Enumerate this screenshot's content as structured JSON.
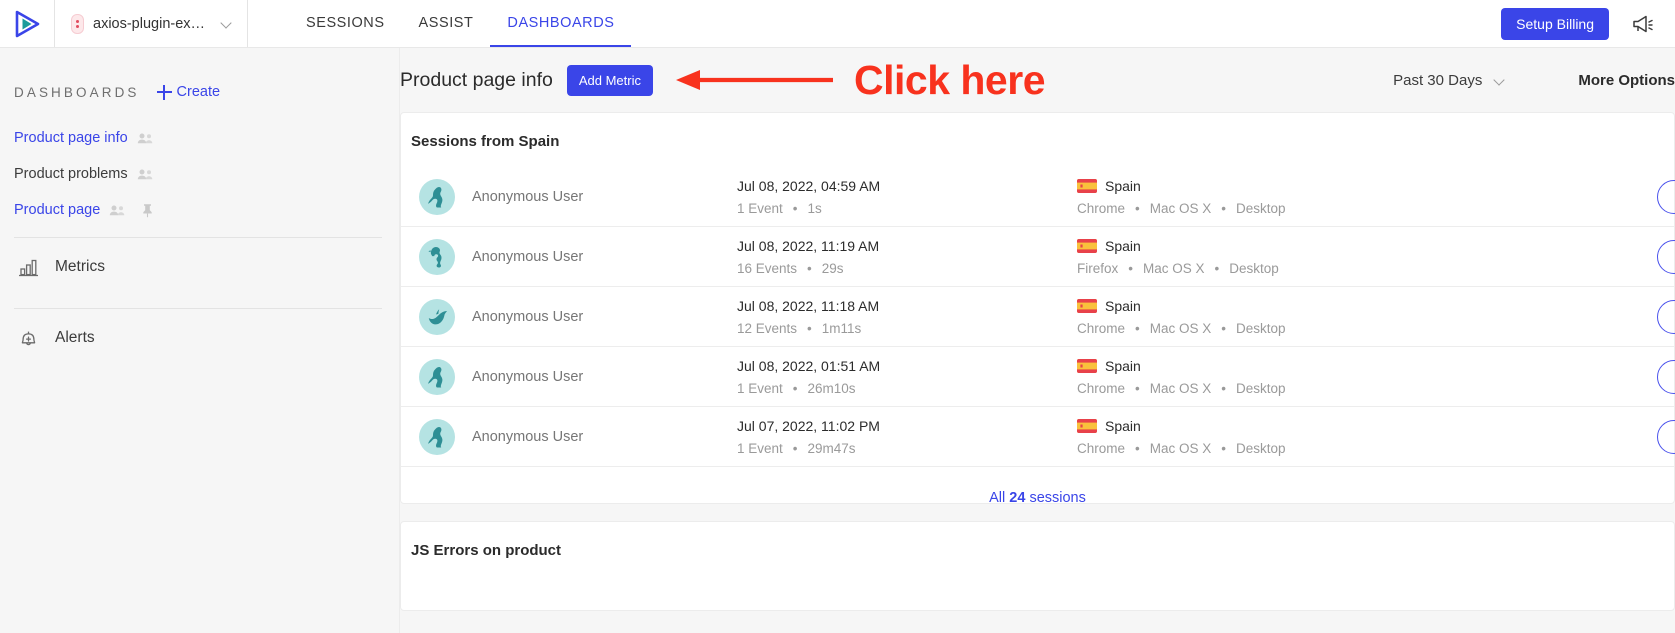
{
  "topbar": {
    "logo_icon": "play-triangle-logo",
    "project": {
      "name": "axios-plugin-exam...",
      "icon": "project-marker-icon",
      "chevron_icon": "chevron-down-icon"
    },
    "nav": [
      {
        "label": "SESSIONS",
        "active": false
      },
      {
        "label": "ASSIST",
        "active": false
      },
      {
        "label": "DASHBOARDS",
        "active": true
      }
    ],
    "billing_button": "Setup Billing",
    "announce_icon": "megaphone-icon"
  },
  "sidebar": {
    "section_label": "DASHBOARDS",
    "create_label": "Create",
    "create_icon": "plus-icon",
    "dashboards": [
      {
        "label": "Product page info",
        "style": "link",
        "people_icon": "people-icon",
        "pinned": false
      },
      {
        "label": "Product problems",
        "style": "plain",
        "people_icon": "people-icon",
        "pinned": false
      },
      {
        "label": "Product page",
        "style": "link",
        "people_icon": "people-icon",
        "pinned": true,
        "pin_icon": "pin-icon"
      }
    ],
    "nav": [
      {
        "label": "Metrics",
        "icon": "bar-chart-icon"
      },
      {
        "label": "Alerts",
        "icon": "bell-plus-icon"
      }
    ]
  },
  "main": {
    "page_title": "Product page info",
    "add_metric_label": "Add Metric",
    "annotation": {
      "text": "Click here",
      "color": "#f8321e",
      "arrow_icon": "left-arrow-annotation"
    },
    "date_range": {
      "label": "Past 30 Days",
      "chevron_icon": "chevron-down-icon"
    },
    "more_options": "More Options",
    "cards": [
      {
        "title": "Sessions from Spain",
        "footer_prefix": "All ",
        "footer_count": "24",
        "footer_suffix": " sessions",
        "rows": [
          {
            "user": "Anonymous User",
            "avatar_icon": "kangaroo-avatar-icon",
            "date": "Jul 08, 2022, 04:59 AM",
            "events": "1 Event",
            "duration": "1s",
            "country": "Spain",
            "flag_icon": "spain-flag-icon",
            "browser": "Chrome",
            "os": "Mac OS X",
            "device": "Desktop",
            "play_icon": "play-circle-icon"
          },
          {
            "user": "Anonymous User",
            "avatar_icon": "seahorse-avatar-icon",
            "date": "Jul 08, 2022, 11:19 AM",
            "events": "16 Events",
            "duration": "29s",
            "country": "Spain",
            "flag_icon": "spain-flag-icon",
            "browser": "Firefox",
            "os": "Mac OS X",
            "device": "Desktop",
            "play_icon": "play-circle-icon"
          },
          {
            "user": "Anonymous User",
            "avatar_icon": "dolphin-avatar-icon",
            "date": "Jul 08, 2022, 11:18 AM",
            "events": "12 Events",
            "duration": "1m11s",
            "country": "Spain",
            "flag_icon": "spain-flag-icon",
            "browser": "Chrome",
            "os": "Mac OS X",
            "device": "Desktop",
            "play_icon": "play-circle-icon"
          },
          {
            "user": "Anonymous User",
            "avatar_icon": "kangaroo-avatar-icon",
            "date": "Jul 08, 2022, 01:51 AM",
            "events": "1 Event",
            "duration": "26m10s",
            "country": "Spain",
            "flag_icon": "spain-flag-icon",
            "browser": "Chrome",
            "os": "Mac OS X",
            "device": "Desktop",
            "play_icon": "play-circle-icon"
          },
          {
            "user": "Anonymous User",
            "avatar_icon": "kangaroo-avatar-icon",
            "date": "Jul 07, 2022, 11:02 PM",
            "events": "1 Event",
            "duration": "29m47s",
            "country": "Spain",
            "flag_icon": "spain-flag-icon",
            "browser": "Chrome",
            "os": "Mac OS X",
            "device": "Desktop",
            "play_icon": "play-circle-icon"
          }
        ]
      },
      {
        "title": "JS Errors on product"
      }
    ],
    "separators": {
      "dot": "•"
    }
  },
  "colors": {
    "accent": "#3a45e8",
    "annotation": "#f8321e",
    "avatar_bg": "#b5e3e3",
    "avatar_fg": "#2e8f95"
  }
}
